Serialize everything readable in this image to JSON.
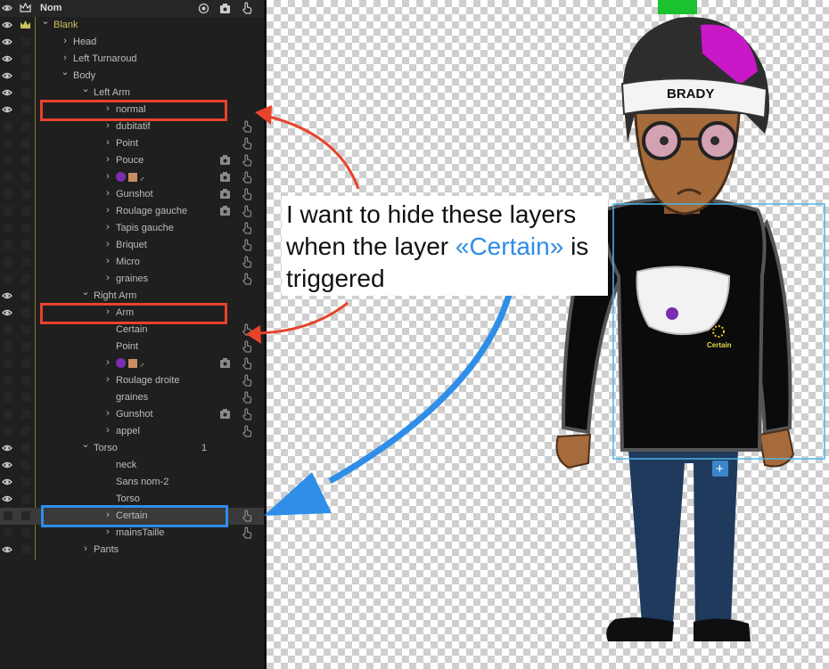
{
  "layers_panel": {
    "header": {
      "name_label": "Nom"
    },
    "rows": [
      {
        "label": "Blank",
        "indent": 0,
        "chevron": "down",
        "eye": true,
        "crown": true,
        "color": "#c8c35a"
      },
      {
        "label": "Head",
        "indent": 1,
        "chevron": "right",
        "eye": true
      },
      {
        "label": "Left Turnaroud",
        "indent": 1,
        "chevron": "right",
        "eye": true
      },
      {
        "label": "Body",
        "indent": 1,
        "chevron": "down",
        "eye": true
      },
      {
        "label": "Left Arm",
        "indent": 2,
        "chevron": "down",
        "eye": true
      },
      {
        "label": "normal",
        "indent": 3,
        "chevron": "right",
        "eye": true
      },
      {
        "label": "dubitatif",
        "indent": 3,
        "chevron": "right",
        "eye": false,
        "trigger": true
      },
      {
        "label": "Point",
        "indent": 3,
        "chevron": "right",
        "eye": false,
        "trigger": true
      },
      {
        "label": "Pouce",
        "indent": 3,
        "chevron": "right",
        "eye": false,
        "trigger": true,
        "cam": true
      },
      {
        "label": "",
        "indent": 3,
        "chevron": "right",
        "eye": false,
        "trigger": true,
        "cam": true,
        "emoji": true
      },
      {
        "label": "Gunshot",
        "indent": 3,
        "chevron": "right",
        "eye": false,
        "trigger": true,
        "cam": true
      },
      {
        "label": "Roulage gauche",
        "indent": 3,
        "chevron": "right",
        "eye": false,
        "trigger": true,
        "cam": true
      },
      {
        "label": "Tapis gauche",
        "indent": 3,
        "chevron": "right",
        "eye": false,
        "trigger": true
      },
      {
        "label": "Briquet",
        "indent": 3,
        "chevron": "right",
        "eye": false,
        "trigger": true
      },
      {
        "label": "Micro",
        "indent": 3,
        "chevron": "right",
        "eye": false,
        "trigger": true
      },
      {
        "label": "graines",
        "indent": 3,
        "chevron": "right",
        "eye": false,
        "trigger": true
      },
      {
        "label": "Right Arm",
        "indent": 2,
        "chevron": "down",
        "eye": true
      },
      {
        "label": "Arm",
        "indent": 3,
        "chevron": "right",
        "eye": true
      },
      {
        "label": "Certain",
        "indent": 3,
        "chevron": "",
        "eye": false,
        "trigger": true
      },
      {
        "label": "Point",
        "indent": 3,
        "chevron": "",
        "eye": false,
        "trigger": true
      },
      {
        "label": "",
        "indent": 3,
        "chevron": "right",
        "eye": false,
        "trigger": true,
        "cam": true,
        "emoji": true
      },
      {
        "label": "Roulage droite",
        "indent": 3,
        "chevron": "right",
        "eye": false,
        "trigger": true
      },
      {
        "label": "graines",
        "indent": 3,
        "chevron": "",
        "eye": false,
        "trigger": true
      },
      {
        "label": "Gunshot",
        "indent": 3,
        "chevron": "right",
        "eye": false,
        "trigger": true,
        "cam": true
      },
      {
        "label": "appel",
        "indent": 3,
        "chevron": "right",
        "eye": false,
        "trigger": true
      },
      {
        "label": "Torso",
        "indent": 2,
        "chevron": "down",
        "eye": true,
        "num": "1"
      },
      {
        "label": "neck",
        "indent": 3,
        "chevron": "",
        "eye": true
      },
      {
        "label": "Sans nom-2",
        "indent": 3,
        "chevron": "",
        "eye": true
      },
      {
        "label": "Torso",
        "indent": 3,
        "chevron": "",
        "eye": true
      },
      {
        "label": "Certain",
        "indent": 3,
        "chevron": "right",
        "eye": false,
        "trigger": true,
        "selected": true
      },
      {
        "label": "mainsTaille",
        "indent": 3,
        "chevron": "right",
        "eye": false,
        "trigger": true
      },
      {
        "label": "Pants",
        "indent": 2,
        "chevron": "right",
        "eye": true
      }
    ]
  },
  "callout": {
    "line1": "I want to hide these layers",
    "line2_a": "when the layer ",
    "line2_b": "«Certain»",
    "line2_c": " is",
    "line3": "triggered"
  },
  "character": {
    "headband_text": "BRADY",
    "bag_tag": "Certain"
  },
  "colors": {
    "panel_bg": "#1f1f1f",
    "guide": "#7d7a2c",
    "red_highlight": "#e8432b",
    "blue_highlight": "#2e8ee8",
    "selection_box": "#4ab7e8"
  }
}
